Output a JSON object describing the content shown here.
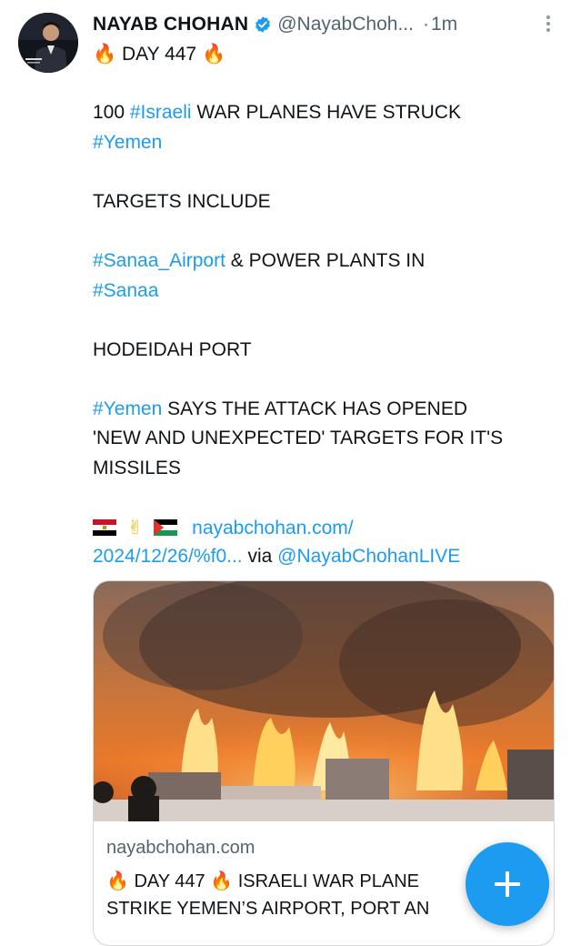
{
  "tweet": {
    "author_name": "NAYAB CHOHAN",
    "handle": "@NayabChoh...",
    "separator": "·",
    "time": "1m",
    "day_text": "DAY 447",
    "line_100": "100 ",
    "tag_israeli": "#Israeli",
    "line_warplanes": " WAR PLANES HAVE STRUCK",
    "tag_yemen": "#Yemen",
    "targets_include": "TARGETS INCLUDE",
    "tag_sanaa_airport": "#Sanaa_Airport",
    "power_plants": " & POWER PLANTS IN",
    "tag_sanaa": "#Sanaa",
    "hodeidah": "HODEIDAH PORT",
    "tag_yemen2": "#Yemen",
    "says_text": " SAYS THE ATTACK HAS OPENED",
    "new_unexpected": "'NEW AND UNEXPECTED' TARGETS FOR IT'S",
    "missiles": "MISSILES",
    "link_part1": "nayabchohan.com/",
    "link_part2": "2024/12/26/%f0...",
    "via_text": " via ",
    "via_handle": "@NayabChohanLIVE",
    "emoji_fire": "🔥",
    "emoji_victory": "✌"
  },
  "card": {
    "domain": "nayabchohan.com",
    "title_line1_text": " DAY 447 ",
    "title_line1_rest": " ISRAELI WAR PLANE",
    "title_line2": "STRIKE YEMEN’S AIRPORT, PORT AN"
  },
  "fab": {
    "icon": "plus"
  },
  "colors": {
    "link": "#1d9bf0",
    "verified": "#1d9bf0",
    "fab": "#1d9bf0"
  }
}
